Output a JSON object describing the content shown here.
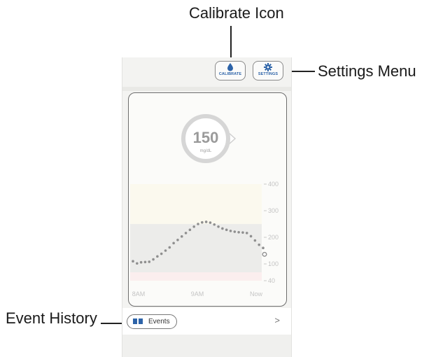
{
  "callouts": {
    "calibrate": "Calibrate Icon",
    "settings": "Settings Menu",
    "events": "Event History"
  },
  "toolbar": {
    "calibrate_label": "CALIBRATE",
    "settings_label": "SETTINGS",
    "calibrate_icon": "drop-icon",
    "settings_icon": "gear-icon",
    "accent": "#2d63a8"
  },
  "reading": {
    "value": "150",
    "unit": "mg/dL",
    "trend": "steady"
  },
  "events": {
    "label": "Events",
    "icon": "book-icon",
    "chevron": ">"
  },
  "chart_data": {
    "type": "scatter",
    "title": "",
    "xlabel": "",
    "ylabel": "",
    "x_tick_labels": [
      "8AM",
      "9AM",
      "Now"
    ],
    "y_tick_labels": [
      "40",
      "100",
      "200",
      "300",
      "400"
    ],
    "ylim": [
      40,
      400
    ],
    "bands": [
      {
        "from": 40,
        "to": 70,
        "color": "#fbeeee"
      },
      {
        "from": 70,
        "to": 250,
        "color": "#ececea"
      },
      {
        "from": 250,
        "to": 400,
        "color": "#fbf9ee"
      }
    ],
    "series": [
      {
        "points": [
          [
            0,
            110
          ],
          [
            3,
            102
          ],
          [
            6,
            106
          ],
          [
            9,
            107
          ],
          [
            12,
            108
          ],
          [
            15,
            117
          ],
          [
            18,
            128
          ],
          [
            21,
            138
          ],
          [
            24,
            150
          ],
          [
            27,
            162
          ],
          [
            30,
            178
          ],
          [
            33,
            190
          ],
          [
            36,
            203
          ],
          [
            39,
            216
          ],
          [
            42,
            228
          ],
          [
            45,
            240
          ],
          [
            48,
            250
          ],
          [
            51,
            256
          ],
          [
            54,
            258
          ],
          [
            57,
            255
          ],
          [
            60,
            248
          ],
          [
            63,
            240
          ],
          [
            66,
            233
          ],
          [
            69,
            228
          ],
          [
            72,
            224
          ],
          [
            75,
            221
          ],
          [
            78,
            219
          ],
          [
            81,
            218
          ],
          [
            84,
            216
          ],
          [
            87,
            204
          ],
          [
            90,
            188
          ],
          [
            93,
            172
          ],
          [
            96,
            160
          ]
        ],
        "current_point": [
          96,
          136
        ]
      }
    ]
  }
}
